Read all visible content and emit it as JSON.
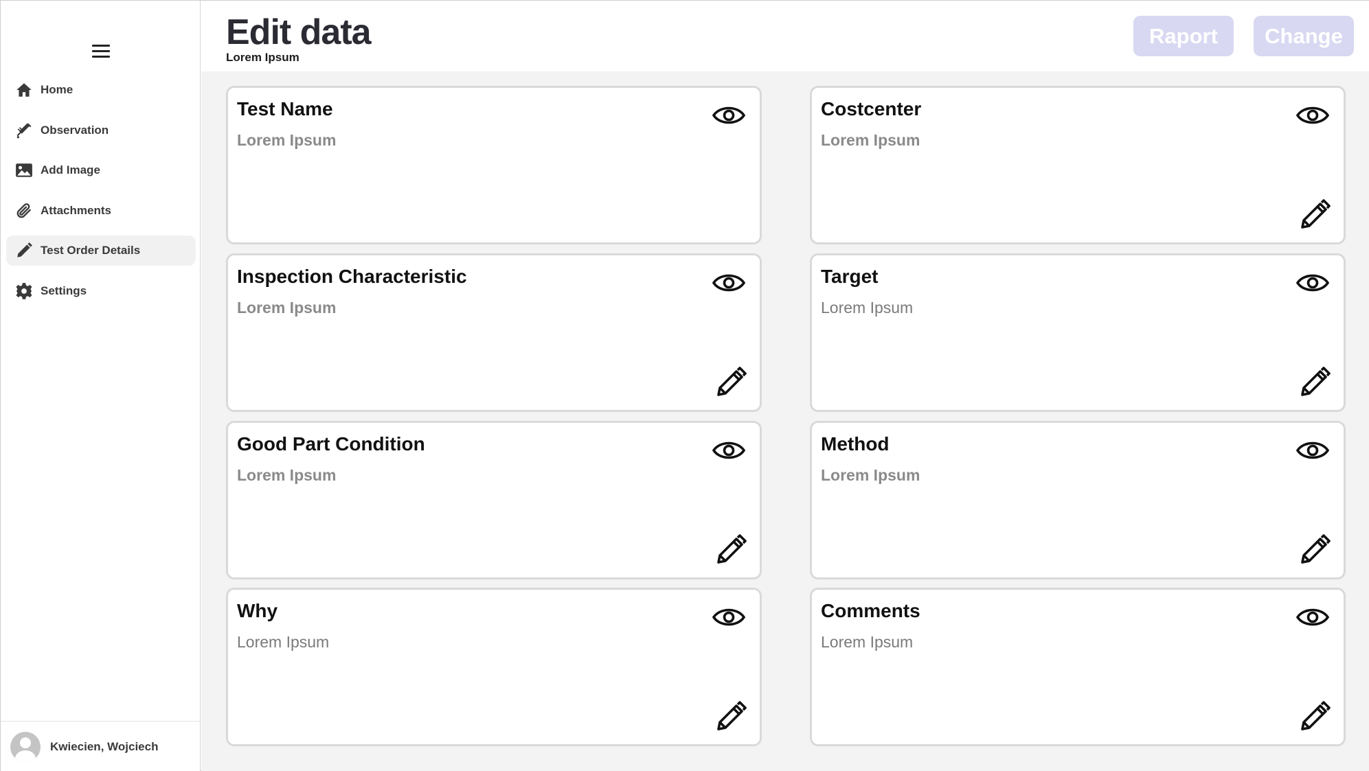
{
  "sidebar": {
    "items": [
      {
        "label": "Home",
        "icon": "home-icon"
      },
      {
        "label": "Observation",
        "icon": "syringe-icon"
      },
      {
        "label": "Add Image",
        "icon": "image-icon"
      },
      {
        "label": "Attachments",
        "icon": "paperclip-icon"
      },
      {
        "label": "Test Order Details",
        "icon": "pencil-icon",
        "active": true
      },
      {
        "label": "Settings",
        "icon": "gear-icon"
      }
    ],
    "user": {
      "name": "Kwiecien, Wojciech"
    }
  },
  "header": {
    "title": "Edit data",
    "subtitle": "Lorem Ipsum",
    "raport_label": "Raport",
    "change_label": "Change"
  },
  "cards": [
    {
      "title": "Test Name",
      "value": "Lorem Ipsum",
      "has_edit": false
    },
    {
      "title": "Costcenter",
      "value": "Lorem Ipsum",
      "has_edit": true
    },
    {
      "title": "Inspection Characteristic",
      "value": "Lorem Ipsum",
      "has_edit": true
    },
    {
      "title": "Target",
      "value": "Lorem Ipsum",
      "has_edit": true
    },
    {
      "title": "Good Part Condition",
      "value": "Lorem Ipsum",
      "has_edit": true
    },
    {
      "title": "Method",
      "value": "Lorem Ipsum",
      "has_edit": true
    },
    {
      "title": "Why",
      "value": "Lorem Ipsum",
      "has_edit": true
    },
    {
      "title": "Comments",
      "value": "Lorem Ipsum",
      "has_edit": true
    }
  ],
  "colors": {
    "button_bg": "#d8d8f2",
    "main_bg": "#f3f3f3",
    "active_nav_bg": "#f1f1f1"
  }
}
